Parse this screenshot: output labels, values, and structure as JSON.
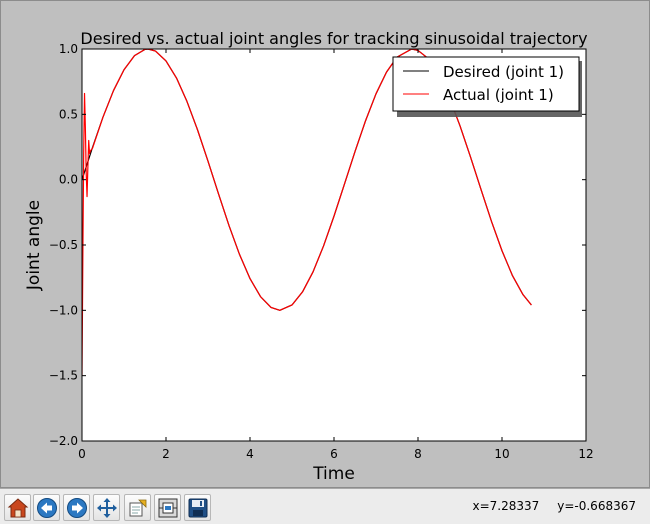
{
  "chart_data": {
    "type": "line",
    "title": "Desired vs. actual joint angles for tracking sinusoidal trajectory",
    "xlabel": "Time",
    "ylabel": "Joint angle",
    "xlim": [
      0,
      12
    ],
    "ylim": [
      -2.0,
      1.0
    ],
    "xticks": [
      "0",
      "2",
      "4",
      "6",
      "8",
      "10",
      "12"
    ],
    "yticks": [
      "1.0",
      "0.5",
      "0.0",
      "−0.5",
      "−1.0",
      "−1.5",
      "−2.0"
    ],
    "grid": false,
    "legend_position": "top-right",
    "series": [
      {
        "name": "Desired (joint 1)",
        "color": "#000000",
        "x": [
          0,
          0.25,
          0.5,
          0.75,
          1.0,
          1.25,
          1.5,
          1.57,
          1.75,
          2.0,
          2.25,
          2.5,
          2.75,
          3.0,
          3.25,
          3.5,
          3.75,
          4.0,
          4.25,
          4.5,
          4.71,
          5.0,
          5.25,
          5.5,
          5.75,
          6.0,
          6.25,
          6.5,
          6.75,
          7.0,
          7.25,
          7.5,
          7.85,
          8.0,
          8.25,
          8.5,
          8.75,
          9.0,
          9.25,
          9.5,
          9.75,
          10.0,
          10.25,
          10.5,
          10.7
        ],
        "y": [
          0,
          0.247,
          0.479,
          0.682,
          0.841,
          0.949,
          0.997,
          1.0,
          0.984,
          0.909,
          0.778,
          0.598,
          0.382,
          0.141,
          -0.108,
          -0.351,
          -0.572,
          -0.757,
          -0.895,
          -0.978,
          -1.0,
          -0.959,
          -0.859,
          -0.706,
          -0.508,
          -0.279,
          -0.033,
          0.215,
          0.45,
          0.657,
          0.823,
          0.938,
          1.0,
          0.989,
          0.926,
          0.798,
          0.624,
          0.412,
          0.174,
          -0.075,
          -0.32,
          -0.544,
          -0.735,
          -0.88,
          -0.959
        ]
      },
      {
        "name": "Actual (joint 1)",
        "color": "#ff0000",
        "x": [
          0,
          0.02,
          0.04,
          0.06,
          0.08,
          0.1,
          0.12,
          0.14,
          0.16,
          0.18,
          0.2,
          0.25,
          0.5,
          0.75,
          1.0,
          1.25,
          1.5,
          1.57,
          1.75,
          2.0,
          2.25,
          2.5,
          2.75,
          3.0,
          3.25,
          3.5,
          3.75,
          4.0,
          4.25,
          4.5,
          4.71,
          5.0,
          5.25,
          5.5,
          5.75,
          6.0,
          6.25,
          6.5,
          6.75,
          7.0,
          7.25,
          7.5,
          7.85,
          8.0,
          8.25,
          8.5,
          8.75,
          9.0,
          9.25,
          9.5,
          9.75,
          10.0,
          10.25,
          10.5,
          10.7
        ],
        "y": [
          -1.5,
          -0.6,
          0.2,
          0.66,
          0.4,
          0.05,
          -0.13,
          0.1,
          0.3,
          0.2,
          0.22,
          0.24,
          0.479,
          0.682,
          0.841,
          0.949,
          0.997,
          1.0,
          0.984,
          0.909,
          0.778,
          0.598,
          0.382,
          0.141,
          -0.108,
          -0.351,
          -0.572,
          -0.757,
          -0.895,
          -0.978,
          -1.0,
          -0.959,
          -0.859,
          -0.706,
          -0.508,
          -0.279,
          -0.033,
          0.215,
          0.45,
          0.657,
          0.823,
          0.938,
          1.0,
          0.989,
          0.926,
          0.798,
          0.624,
          0.412,
          0.174,
          -0.075,
          -0.32,
          -0.544,
          -0.735,
          -0.88,
          -0.959
        ]
      }
    ]
  },
  "toolbar": {
    "buttons": [
      {
        "name": "home-button",
        "icon": "home-icon"
      },
      {
        "name": "back-button",
        "icon": "arrow-left-icon"
      },
      {
        "name": "forward-button",
        "icon": "arrow-right-icon"
      },
      {
        "name": "pan-button",
        "icon": "move-icon"
      },
      {
        "name": "zoom-button",
        "icon": "zoom-rect-icon"
      },
      {
        "name": "subplots-button",
        "icon": "subplots-icon"
      },
      {
        "name": "save-button",
        "icon": "save-icon"
      }
    ],
    "coords_x": "x=7.28337",
    "coords_y": "y=-0.668367"
  },
  "colors": {
    "figure_bg": "#bfbfbf",
    "axes_bg": "#ffffff",
    "toolbar_bg": "#ececec"
  }
}
